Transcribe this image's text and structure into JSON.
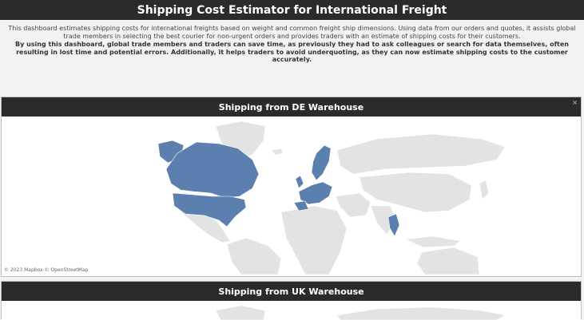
{
  "page": {
    "title": "Shipping Cost Estimator for International Freight"
  },
  "description": {
    "paragraph1": "This dashboard estimates shipping costs for international freights based on weight and common freight ship dimensions. Using data from our orders and quotes, it assists global trade members in selecting the best courier for non-urgent orders and provides traders with an estimate of shipping costs for their customers.",
    "paragraph2": "By using this dashboard, global trade members and traders can save time, as previously they had to ask colleagues or search for data themselves, often resulting in lost time and potential errors. Additionally, it helps traders to avoid underquoting, as they can now estimate shipping costs to the customer accurately."
  },
  "panels": [
    {
      "title": "Shipping from DE Warehouse",
      "close_glyph": "×",
      "attribution": "© 2023 Mapbox  © OpenStreetMap"
    },
    {
      "title": "Shipping from UK Warehouse"
    }
  ],
  "colors": {
    "header_bg": "#2b2b2b",
    "highlight_country": "#5b7fae",
    "other_country": "#e3e3e3",
    "border": "#bfbfbf"
  },
  "icons": {
    "panel_close": "close-icon"
  }
}
